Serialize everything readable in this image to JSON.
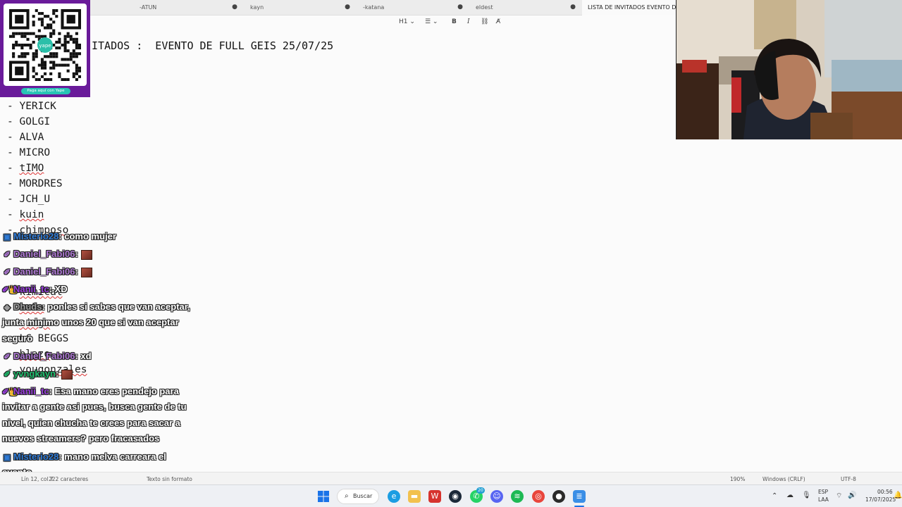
{
  "tabs": [
    {
      "label": "-ATUN",
      "close": "●"
    },
    {
      "label": "kayn",
      "close": "●"
    },
    {
      "label": "-katana",
      "close": "●"
    },
    {
      "label": "eldest",
      "close": "●"
    },
    {
      "label": "LISTA DE INVITADOS   EVENTO DE",
      "close": ""
    }
  ],
  "toolbar": {
    "heading": "H1 ⌄",
    "list": "☰ ⌄",
    "bold": "B",
    "italic": "I",
    "link": "⛓",
    "clear_format": "A̸"
  },
  "document": {
    "title": "ITADOS :  EVENTO DE FULL GEIS 25/07/25",
    "guests": [
      {
        "text": "- YERICK",
        "name": "YERICK",
        "misspelled": false
      },
      {
        "text": "- GOLGI",
        "name": "GOLGI",
        "misspelled": false
      },
      {
        "text": "- ALVA",
        "name": "ALVA",
        "misspelled": false
      },
      {
        "text": "- MICRO",
        "name": "MICRO",
        "misspelled": false
      },
      {
        "text": "- tIMO",
        "name": "tIMO",
        "misspelled": true
      },
      {
        "text": "- MORDRES",
        "name": "MORDRES",
        "misspelled": false
      },
      {
        "text": "- JCH_U",
        "name": "JCH_U",
        "misspelled": false
      },
      {
        "text": "- kuin",
        "name": "kuin",
        "misspelled": true
      },
      {
        "text": "- chimposo",
        "name": "chimposo",
        "misspelled": true
      },
      {
        "text": "",
        "name": "",
        "misspelled": false
      },
      {
        "text": "",
        "name": "",
        "misspelled": false
      },
      {
        "text": "",
        "name": "",
        "misspelled": false
      },
      {
        "text": "- kimicat",
        "name": "kimicat",
        "misspelled": true
      },
      {
        "text": "- zeka",
        "name": "zeka",
        "misspelled": true
      },
      {
        "text": "- zingu",
        "name": "zingu",
        "misspelled": true
      },
      {
        "text": "- LC BEGGS",
        "name": "LC BEGGS",
        "misspelled": false
      },
      {
        "text": "- blazo",
        "name": "blazo",
        "misspelled": true
      },
      {
        "text": "- yougonzales",
        "name": "yougonzales",
        "misspelled": true
      }
    ]
  },
  "qr": {
    "caption": "Paga aquí con Yape",
    "brand": "yape"
  },
  "chat": [
    {
      "user": "Misterio28",
      "text": ": como mujer",
      "color": "#2f7bd6",
      "badge": "▣",
      "emote": false
    },
    {
      "user": "Daniel_Fabi06",
      "text": ":",
      "color": "#b07ad6",
      "badge": "✐",
      "emote": true
    },
    {
      "user": "Daniel_Fabi06",
      "text": ":",
      "color": "#b07ad6",
      "badge": "✐",
      "emote": true
    },
    {
      "user": "Nanii_tc",
      "text": ": XD",
      "color": "#9b3fe0",
      "badge": "✐👑",
      "emote": false
    },
    {
      "user": "Dhuds",
      "text": ": ponles si sabes que van aceptar,",
      "color": "#9a9a9a",
      "badge": "◆",
      "emote": false,
      "cont": [
        "junta minimo unos 20 que si van aceptar",
        "seguro"
      ]
    },
    {
      "user": "Daniel_Fabi06",
      "text": ": xd",
      "color": "#b07ad6",
      "badge": "✐",
      "emote": false
    },
    {
      "user": "yvngkayn",
      "text": ":",
      "color": "#1fbf6e",
      "badge": "✐",
      "emote": true
    },
    {
      "user": "Nanii_tc",
      "text": ": Esa mano eres pendejo para",
      "color": "#9b3fe0",
      "badge": "✐👑",
      "emote": false,
      "cont": [
        "invitar a gente asi pues, busca gente de tu",
        "nivel, quien chucha te crees para sacar a",
        "nuevos streamers? pero fracasados"
      ]
    },
    {
      "user": "Misterio28",
      "text": ": mano melva carreara el",
      "color": "#2f7bd6",
      "badge": "▣",
      "emote": false,
      "cont": [
        "evento"
      ]
    }
  ],
  "statusbar": {
    "position": "Lín 12, col 7",
    "chars": "222 caracteres",
    "format": "Texto sin formato",
    "zoom": "190%",
    "line_ending": "Windows (CRLF)",
    "encoding": "UTF-8"
  },
  "taskbar": {
    "search_label": "Buscar",
    "lang_top": "ESP",
    "lang_bottom": "LAA",
    "time": "00:56",
    "date": "17/07/2025",
    "whatsapp_badge": "20"
  }
}
